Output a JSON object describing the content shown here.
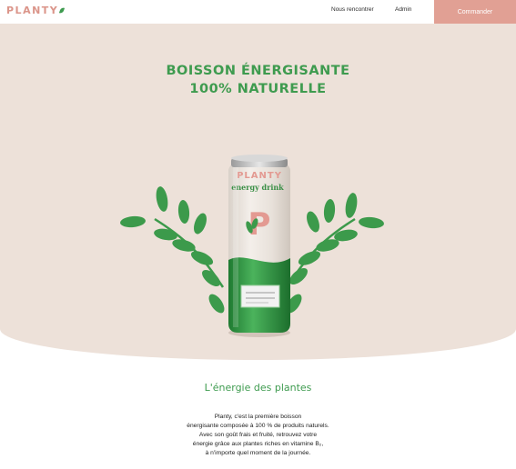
{
  "header": {
    "logo_text": "PLANTY",
    "nav": {
      "meet": "Nous rencontrer",
      "admin": "Admin"
    },
    "order_label": "Commander"
  },
  "hero": {
    "title_line1": "BOISSON ÉNERGISANTE",
    "title_line2": "100% NATURELLE",
    "can": {
      "brand": "PLANTY",
      "subtitle": "energy drink",
      "letter": "P"
    }
  },
  "content": {
    "heading": "L'énergie des plantes",
    "paragraph_lines": [
      "Planty, c'est la première boisson",
      "énergisante composée à 100 % de produits naturels.",
      "Avec son goût frais et fruité, retrouvez votre",
      "énergie grâce aux plantes riches en vitamine B₂,",
      "à n'importe quel moment de la journée."
    ]
  },
  "colors": {
    "brand_green": "#3E9B4F",
    "brand_pink": "#DB958A",
    "hero_bg": "#EDE1D9",
    "button_bg": "#E1A094"
  }
}
